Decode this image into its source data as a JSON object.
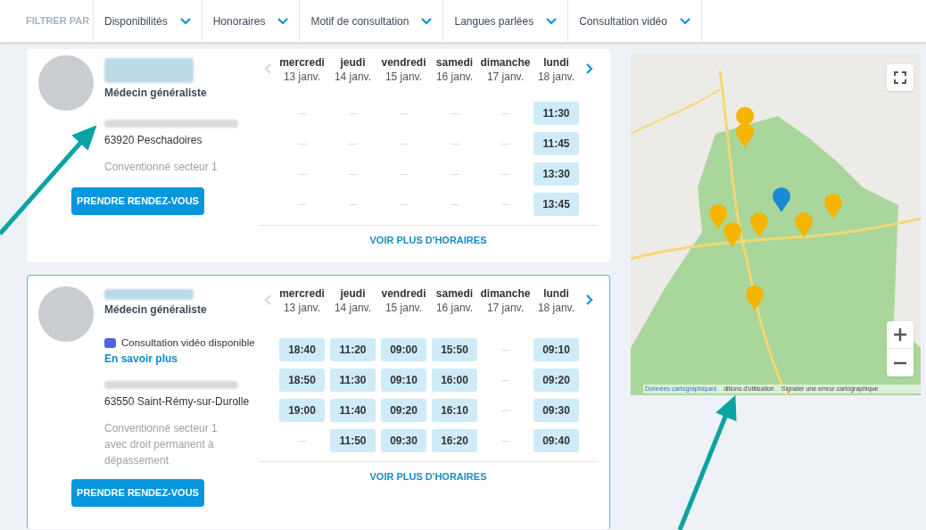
{
  "filter_bar": {
    "label": "FILTRER PAR",
    "filters": [
      {
        "label": "Disponibilités"
      },
      {
        "label": "Honoraires"
      },
      {
        "label": "Motif de consultation"
      },
      {
        "label": "Langues parlées"
      },
      {
        "label": "Consultation vidéo"
      }
    ]
  },
  "doctors": [
    {
      "highlighted": false,
      "specialty": "Médecin généraliste",
      "video": false,
      "city": "63920 Peschadoires",
      "convention": "Conventionné secteur 1",
      "book_button": "PRENDRE RENDEZ-VOUS",
      "days": [
        {
          "day": "mercredi",
          "date": "13 janv."
        },
        {
          "day": "jeudi",
          "date": "14 janv."
        },
        {
          "day": "vendredi",
          "date": "15 janv."
        },
        {
          "day": "samedi",
          "date": "16 janv."
        },
        {
          "day": "dimanche",
          "date": "17 janv."
        },
        {
          "day": "lundi",
          "date": "18 janv."
        }
      ],
      "slot_rows": [
        [
          null,
          null,
          null,
          null,
          null,
          "11:30"
        ],
        [
          null,
          null,
          null,
          null,
          null,
          "11:45"
        ],
        [
          null,
          null,
          null,
          null,
          null,
          "13:30"
        ],
        [
          null,
          null,
          null,
          null,
          null,
          "13:45"
        ]
      ],
      "more_link": "VOIR PLUS D'HORAIRES"
    },
    {
      "highlighted": true,
      "specialty": "Médecin généraliste",
      "video": true,
      "video_label": "Consultation vidéo disponible",
      "video_link": "En savoir plus",
      "city": "63550 Saint-Rémy-sur-Durolle",
      "convention": "Conventionné secteur 1 avec droit permanent à dépassement",
      "book_button": "PRENDRE RENDEZ-VOUS",
      "days": [
        {
          "day": "mercredi",
          "date": "13 janv."
        },
        {
          "day": "jeudi",
          "date": "14 janv."
        },
        {
          "day": "vendredi",
          "date": "15 janv."
        },
        {
          "day": "samedi",
          "date": "16 janv."
        },
        {
          "day": "dimanche",
          "date": "17 janv."
        },
        {
          "day": "lundi",
          "date": "18 janv."
        }
      ],
      "slot_rows": [
        [
          "18:40",
          "11:20",
          "09:00",
          "15:50",
          null,
          "09:10"
        ],
        [
          "18:50",
          "11:30",
          "09:10",
          "16:00",
          null,
          "09:20"
        ],
        [
          "19:00",
          "11:40",
          "09:20",
          "16:10",
          null,
          "09:30"
        ],
        [
          null,
          "11:50",
          "09:30",
          "16:20",
          null,
          "09:40"
        ]
      ],
      "more_link": "VOIR PLUS D'HORAIRES"
    }
  ],
  "map": {
    "attribution": [
      {
        "kind": "link",
        "text": "Données cartographiques"
      },
      {
        "kind": "text",
        "text": "ditions d'utilisation"
      },
      {
        "kind": "text",
        "text": "Signaler une erreur cartographique"
      }
    ]
  }
}
